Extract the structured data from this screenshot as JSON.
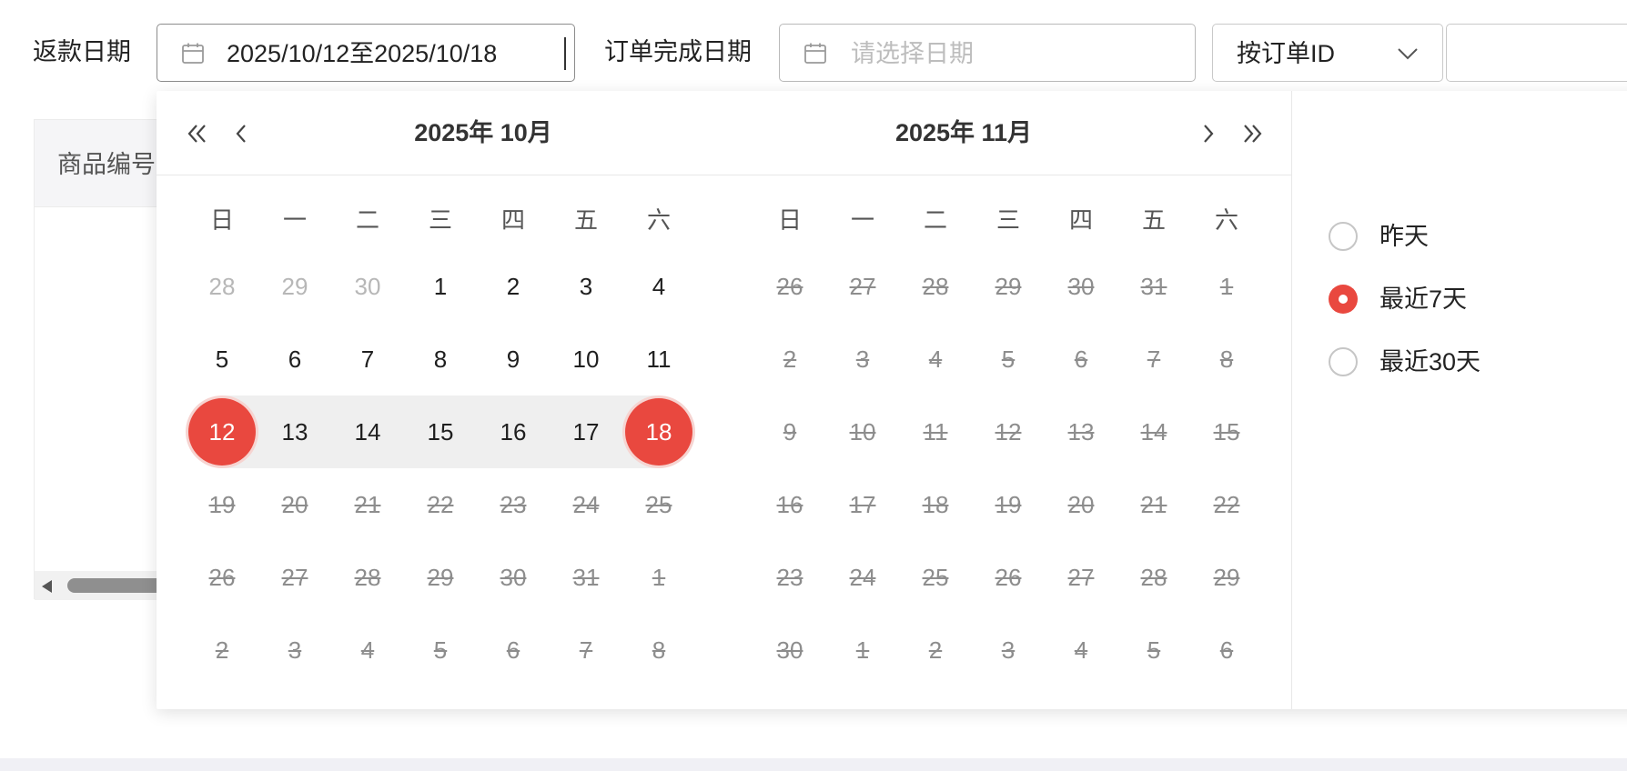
{
  "filters": {
    "refund_date_label": "返款日期",
    "refund_date_value": "2025/10/12至2025/10/18",
    "order_complete_label": "订单完成日期",
    "order_complete_placeholder": "请选择日期",
    "search_type_value": "按订单ID",
    "search_value": ""
  },
  "table": {
    "first_column_header": "商品编号"
  },
  "calendar": {
    "left_title": "2025年 10月",
    "right_title": "2025年 11月",
    "weekdays": [
      "日",
      "一",
      "二",
      "三",
      "四",
      "五",
      "六"
    ],
    "left_days": [
      [
        {
          "d": "28",
          "s": "other"
        },
        {
          "d": "29",
          "s": "other"
        },
        {
          "d": "30",
          "s": "other"
        },
        {
          "d": "1",
          "s": "normal"
        },
        {
          "d": "2",
          "s": "normal"
        },
        {
          "d": "3",
          "s": "normal"
        },
        {
          "d": "4",
          "s": "normal"
        }
      ],
      [
        {
          "d": "5",
          "s": "normal"
        },
        {
          "d": "6",
          "s": "normal"
        },
        {
          "d": "7",
          "s": "normal"
        },
        {
          "d": "8",
          "s": "normal"
        },
        {
          "d": "9",
          "s": "normal"
        },
        {
          "d": "10",
          "s": "normal"
        },
        {
          "d": "11",
          "s": "normal"
        }
      ],
      [
        {
          "d": "12",
          "s": "selected"
        },
        {
          "d": "13",
          "s": "in-range"
        },
        {
          "d": "14",
          "s": "in-range"
        },
        {
          "d": "15",
          "s": "in-range"
        },
        {
          "d": "16",
          "s": "in-range"
        },
        {
          "d": "17",
          "s": "in-range"
        },
        {
          "d": "18",
          "s": "selected"
        }
      ],
      [
        {
          "d": "19",
          "s": "disabled"
        },
        {
          "d": "20",
          "s": "disabled"
        },
        {
          "d": "21",
          "s": "disabled"
        },
        {
          "d": "22",
          "s": "disabled"
        },
        {
          "d": "23",
          "s": "disabled"
        },
        {
          "d": "24",
          "s": "disabled"
        },
        {
          "d": "25",
          "s": "disabled"
        }
      ],
      [
        {
          "d": "26",
          "s": "disabled"
        },
        {
          "d": "27",
          "s": "disabled"
        },
        {
          "d": "28",
          "s": "disabled"
        },
        {
          "d": "29",
          "s": "disabled"
        },
        {
          "d": "30",
          "s": "disabled"
        },
        {
          "d": "31",
          "s": "disabled"
        },
        {
          "d": "1",
          "s": "disabled"
        }
      ],
      [
        {
          "d": "2",
          "s": "disabled"
        },
        {
          "d": "3",
          "s": "disabled"
        },
        {
          "d": "4",
          "s": "disabled"
        },
        {
          "d": "5",
          "s": "disabled"
        },
        {
          "d": "6",
          "s": "disabled"
        },
        {
          "d": "7",
          "s": "disabled"
        },
        {
          "d": "8",
          "s": "disabled"
        }
      ]
    ],
    "right_days": [
      [
        {
          "d": "26",
          "s": "disabled"
        },
        {
          "d": "27",
          "s": "disabled"
        },
        {
          "d": "28",
          "s": "disabled"
        },
        {
          "d": "29",
          "s": "disabled"
        },
        {
          "d": "30",
          "s": "disabled"
        },
        {
          "d": "31",
          "s": "disabled"
        },
        {
          "d": "1",
          "s": "disabled"
        }
      ],
      [
        {
          "d": "2",
          "s": "disabled"
        },
        {
          "d": "3",
          "s": "disabled"
        },
        {
          "d": "4",
          "s": "disabled"
        },
        {
          "d": "5",
          "s": "disabled"
        },
        {
          "d": "6",
          "s": "disabled"
        },
        {
          "d": "7",
          "s": "disabled"
        },
        {
          "d": "8",
          "s": "disabled"
        }
      ],
      [
        {
          "d": "9",
          "s": "disabled"
        },
        {
          "d": "10",
          "s": "disabled"
        },
        {
          "d": "11",
          "s": "disabled"
        },
        {
          "d": "12",
          "s": "disabled"
        },
        {
          "d": "13",
          "s": "disabled"
        },
        {
          "d": "14",
          "s": "disabled"
        },
        {
          "d": "15",
          "s": "disabled"
        }
      ],
      [
        {
          "d": "16",
          "s": "disabled"
        },
        {
          "d": "17",
          "s": "disabled"
        },
        {
          "d": "18",
          "s": "disabled"
        },
        {
          "d": "19",
          "s": "disabled"
        },
        {
          "d": "20",
          "s": "disabled"
        },
        {
          "d": "21",
          "s": "disabled"
        },
        {
          "d": "22",
          "s": "disabled"
        }
      ],
      [
        {
          "d": "23",
          "s": "disabled"
        },
        {
          "d": "24",
          "s": "disabled"
        },
        {
          "d": "25",
          "s": "disabled"
        },
        {
          "d": "26",
          "s": "disabled"
        },
        {
          "d": "27",
          "s": "disabled"
        },
        {
          "d": "28",
          "s": "disabled"
        },
        {
          "d": "29",
          "s": "disabled"
        }
      ],
      [
        {
          "d": "30",
          "s": "disabled"
        },
        {
          "d": "1",
          "s": "disabled"
        },
        {
          "d": "2",
          "s": "disabled"
        },
        {
          "d": "3",
          "s": "disabled"
        },
        {
          "d": "4",
          "s": "disabled"
        },
        {
          "d": "5",
          "s": "disabled"
        },
        {
          "d": "6",
          "s": "disabled"
        }
      ]
    ]
  },
  "quick_ranges": {
    "items": [
      {
        "label": "昨天",
        "checked": false
      },
      {
        "label": "最近7天",
        "checked": true
      },
      {
        "label": "最近30天",
        "checked": false
      }
    ]
  },
  "icons": {
    "date_input": "calendar-icon",
    "select": "chevron-down-icon",
    "prev_year": "double-chevron-left-icon",
    "prev_month": "chevron-left-icon",
    "next_month": "chevron-right-icon",
    "next_year": "double-chevron-right-icon"
  },
  "colors": {
    "accent": "#e9483f",
    "range_background": "#efefef",
    "disabled_text": "#8d8d8d",
    "other_month_text": "#b7b7b7"
  }
}
